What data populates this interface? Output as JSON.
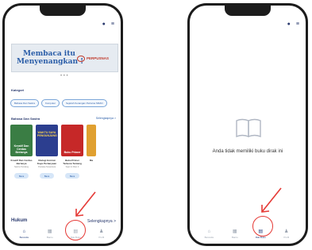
{
  "left_screen": {
    "banner": {
      "line1": "Membaca itu",
      "line2": "Menyenangkan !",
      "logo_text": "PERPUSNAS"
    },
    "kategori": {
      "title": "Kategori",
      "chips": [
        "Bahasa Dan Sastra",
        "Komputer",
        "Sejarah Kenangan Pertama SMAN"
      ]
    },
    "section": {
      "title": "Bahasa Dan Sastra",
      "see_all": "Selengkapnya >"
    },
    "books": [
      {
        "cover_text": "Kreatif Dan Cerdas Bertanya",
        "title": "Kreatif Dan Cerdas Bertanya",
        "author": "Sastra Tandang",
        "button": "Baca",
        "color": "#3a7d44"
      },
      {
        "cover_text": "WAKTU SAYA PENGUNJUNG",
        "title": "Dialogi Hormat Kaya Pertanyaan",
        "author": "Pustaka Nusantara",
        "button": "Baca",
        "color": "#2c3e8f"
      },
      {
        "cover_text": "Buku Primer",
        "title": "Buku Primer Terkena Tentang",
        "author": "Sapri & Rian 2",
        "button": "Baca",
        "color": "#c62828"
      },
      {
        "cover_text": "",
        "title": "Ma",
        "author": "",
        "button": "",
        "color": "#e0a030"
      }
    ],
    "hukum": "Hukum",
    "selengkapnya": "Selengkapnya >",
    "nav": [
      {
        "label": "Beranda",
        "icon": "home-icon",
        "active": true
      },
      {
        "label": "Bantu",
        "icon": "calendar-icon",
        "active": false
      },
      {
        "label": "Rak Buku",
        "icon": "bookshelf-icon",
        "active": false
      },
      {
        "label": "Profil",
        "icon": "person-icon",
        "active": false
      }
    ]
  },
  "right_screen": {
    "empty_message": "Anda tidak memiliki buku dirak ini",
    "nav": [
      {
        "label": "Beranda",
        "icon": "home-icon",
        "active": false
      },
      {
        "label": "Bantu",
        "icon": "calendar-icon",
        "active": false
      },
      {
        "label": "Rak Buku",
        "icon": "bookshelf-icon",
        "active": true
      },
      {
        "label": "Profil",
        "icon": "person-icon",
        "active": false
      }
    ]
  },
  "colors": {
    "accent": "#1f3a7a",
    "annotation": "#e53935",
    "chip_border": "#7da7d9"
  }
}
